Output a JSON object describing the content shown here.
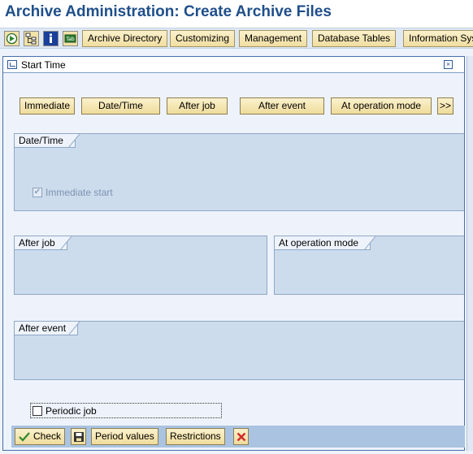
{
  "app": {
    "title": "Archive Administration: Create Archive Files"
  },
  "toolbar": {
    "icons": [
      "execute-icon",
      "hierarchy-icon",
      "info-icon",
      "tab-icon"
    ],
    "buttons": [
      "Archive Directory",
      "Customizing",
      "Management",
      "Database Tables",
      "Information Sys"
    ]
  },
  "dialog": {
    "title": "Start Time",
    "start_options": [
      "Immediate",
      "Date/Time",
      "After job",
      "After event",
      "At operation mode",
      ">>"
    ],
    "groups": {
      "date_time": {
        "title": "Date/Time",
        "immediate_start_label": "Immediate start",
        "immediate_start_checked": true
      },
      "after_job": {
        "title": "After job"
      },
      "operation_mode": {
        "title": "At operation mode"
      },
      "after_event": {
        "title": "After event"
      }
    },
    "periodic_job": {
      "label": "Periodic job",
      "checked": false
    },
    "footer": {
      "check_label": "Check",
      "period_values_label": "Period values",
      "restrictions_label": "Restrictions"
    }
  },
  "colors": {
    "title_blue": "#1f4f8a",
    "button_yellow": "#f6e7b0",
    "group_blue": "#ccdcec",
    "footer_blue": "#a9c3e1",
    "cancel_red": "#d0302b",
    "check_green": "#2e8b2e"
  }
}
